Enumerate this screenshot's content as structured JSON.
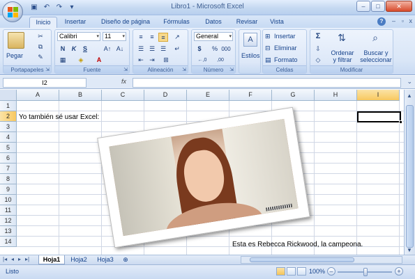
{
  "window": {
    "title": "Libro1 - Microsoft Excel",
    "minimize": "–",
    "maximize": "□",
    "close": "✕"
  },
  "qat": [
    "save-icon",
    "undo-icon",
    "redo-icon",
    "customize-icon"
  ],
  "ribbon_tabs": [
    "Inicio",
    "Insertar",
    "Diseño de página",
    "Fórmulas",
    "Datos",
    "Revisar",
    "Vista"
  ],
  "active_tab": "Inicio",
  "ribbon": {
    "clipboard": {
      "label": "Portapapeles",
      "paste": "Pegar"
    },
    "font": {
      "label": "Fuente",
      "family": "Calibri",
      "size": "11",
      "bold": "N",
      "italic": "K",
      "underline": "S"
    },
    "alignment": {
      "label": "Alineación"
    },
    "number": {
      "label": "Número",
      "format": "General",
      "currency": "$",
      "percent": "%",
      "thousands": "000",
      "inc_dec": "←,0",
      "dec_dec": ",00"
    },
    "styles": {
      "label": "Estilos"
    },
    "cells": {
      "label": "Celdas",
      "insert": "Insertar",
      "delete": "Eliminar",
      "format": "Formato"
    },
    "editing": {
      "label": "Modificar",
      "sort": "Ordenar\ny filtrar",
      "sort_l1": "Ordenar",
      "sort_l2": "y filtrar",
      "find_l1": "Buscar y",
      "find_l2": "seleccionar",
      "sum": "Σ"
    }
  },
  "formula_bar": {
    "name_box": "I2",
    "fx": "fx",
    "value": ""
  },
  "grid": {
    "columns": [
      "A",
      "B",
      "C",
      "D",
      "E",
      "F",
      "G",
      "H",
      "I"
    ],
    "selected_column": "I",
    "rows": [
      "1",
      "2",
      "3",
      "4",
      "5",
      "6",
      "7",
      "8",
      "9",
      "10",
      "11",
      "12",
      "13",
      "14"
    ],
    "selected_row": "2",
    "cells": {
      "A2": "Yo también sé usar Excel:",
      "F14": "Esta es Rebecca Rickwood, la campeona."
    }
  },
  "sheets": [
    "Hoja1",
    "Hoja2",
    "Hoja3"
  ],
  "active_sheet": "Hoja1",
  "status": {
    "text": "Listo",
    "zoom": "100%"
  },
  "colors": {
    "ribbon": "#dbe7f8",
    "selected_header": "#f8c85f",
    "gridline": "#d0d7e5"
  }
}
